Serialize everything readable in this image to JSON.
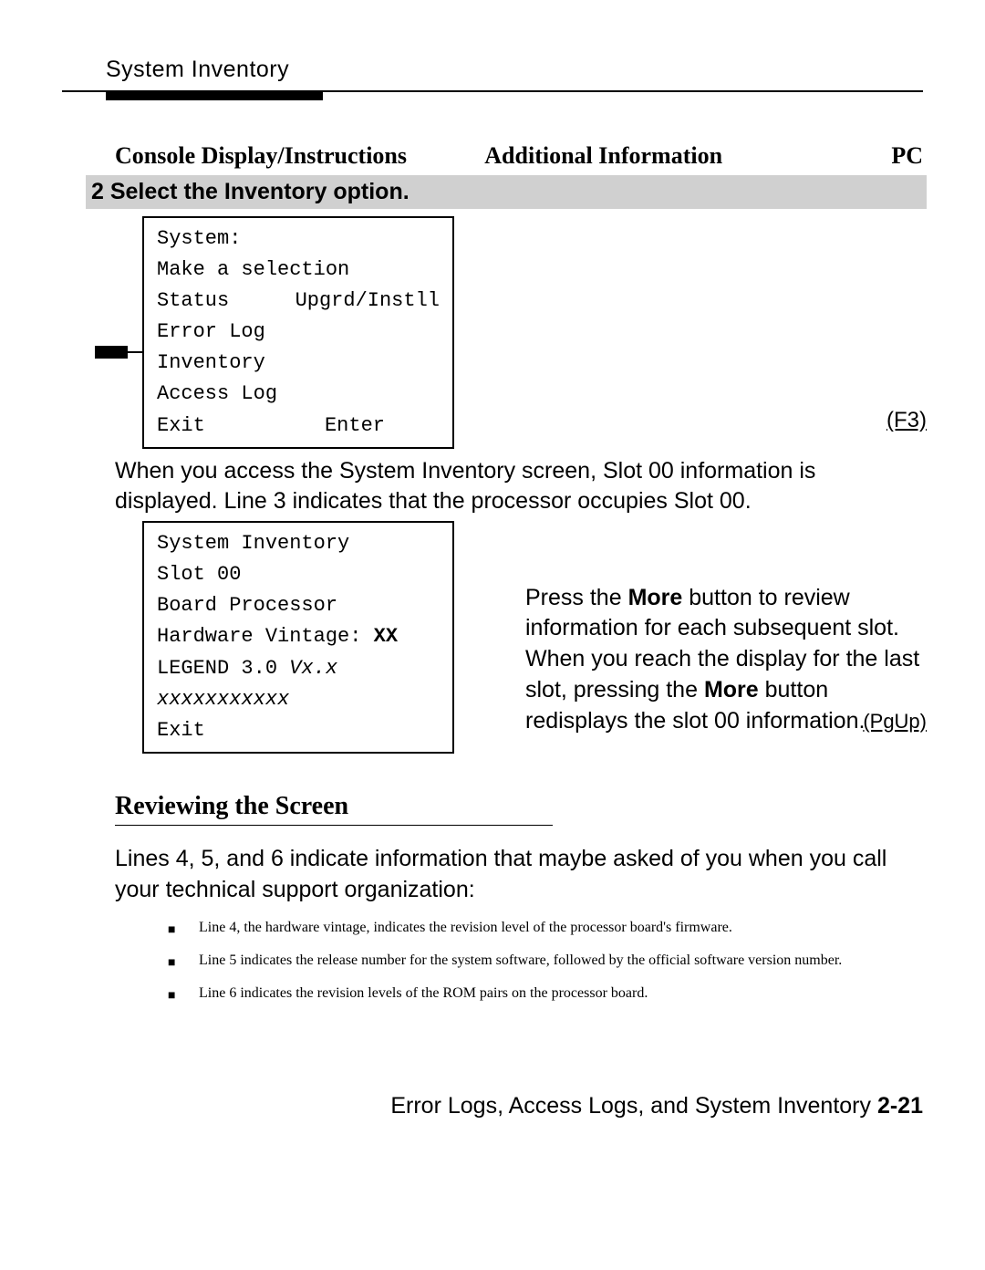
{
  "header": {
    "title": "System Inventory"
  },
  "columns": {
    "left": "Console Display/Instructions",
    "center": "Additional Information",
    "right": "PC"
  },
  "step2": {
    "label": "2 Select the Inventory option."
  },
  "console1": {
    "l1": "System:",
    "l2": "Make a selection",
    "l3a": "Status",
    "l3b": "Upgrd/Instll",
    "l4": "Error Log",
    "l5": "Inventory",
    "l6": "Access Log",
    "l7a": "Exit",
    "l7b": "Enter"
  },
  "pc1": "(F3)",
  "para1": "When you access the System Inventory screen, Slot 00 information is displayed. Line 3 indicates that the processor occupies Slot 00.",
  "console2": {
    "l1": "System Inventory",
    "l2": "Slot 00",
    "l3": "Board Processor",
    "l4a": "Hardware Vintage:",
    "l4b": "XX",
    "l5a": "LEGEND 3.0",
    "l5b": "Vx.x",
    "l6": "xxxxxxxxxxx",
    "l7": "Exit"
  },
  "desc": {
    "pad": " ",
    "t1a": "Press the ",
    "t1b": "More",
    "t1c": " button to review information for each subsequent slot. When you reach the display for the last slot, pressing the ",
    "t1d": "More",
    "t1e": " button redisplays the slot 00 information."
  },
  "pc2": "(PgUp)",
  "section": {
    "title": "Reviewing the Screen",
    "intro": "Lines 4, 5, and 6 indicate information that maybe asked of you when you call your technical support organization:",
    "b1": "Line 4, the hardware vintage, indicates the revision level of the processor board's firmware.",
    "b2": "Line 5 indicates the release number for the system software, followed by the official software version number.",
    "b3": "Line 6 indicates the revision levels of the ROM pairs on the processor board."
  },
  "footer": {
    "text": "Error Logs, Access Logs, and System Inventory ",
    "page": "2-21"
  }
}
